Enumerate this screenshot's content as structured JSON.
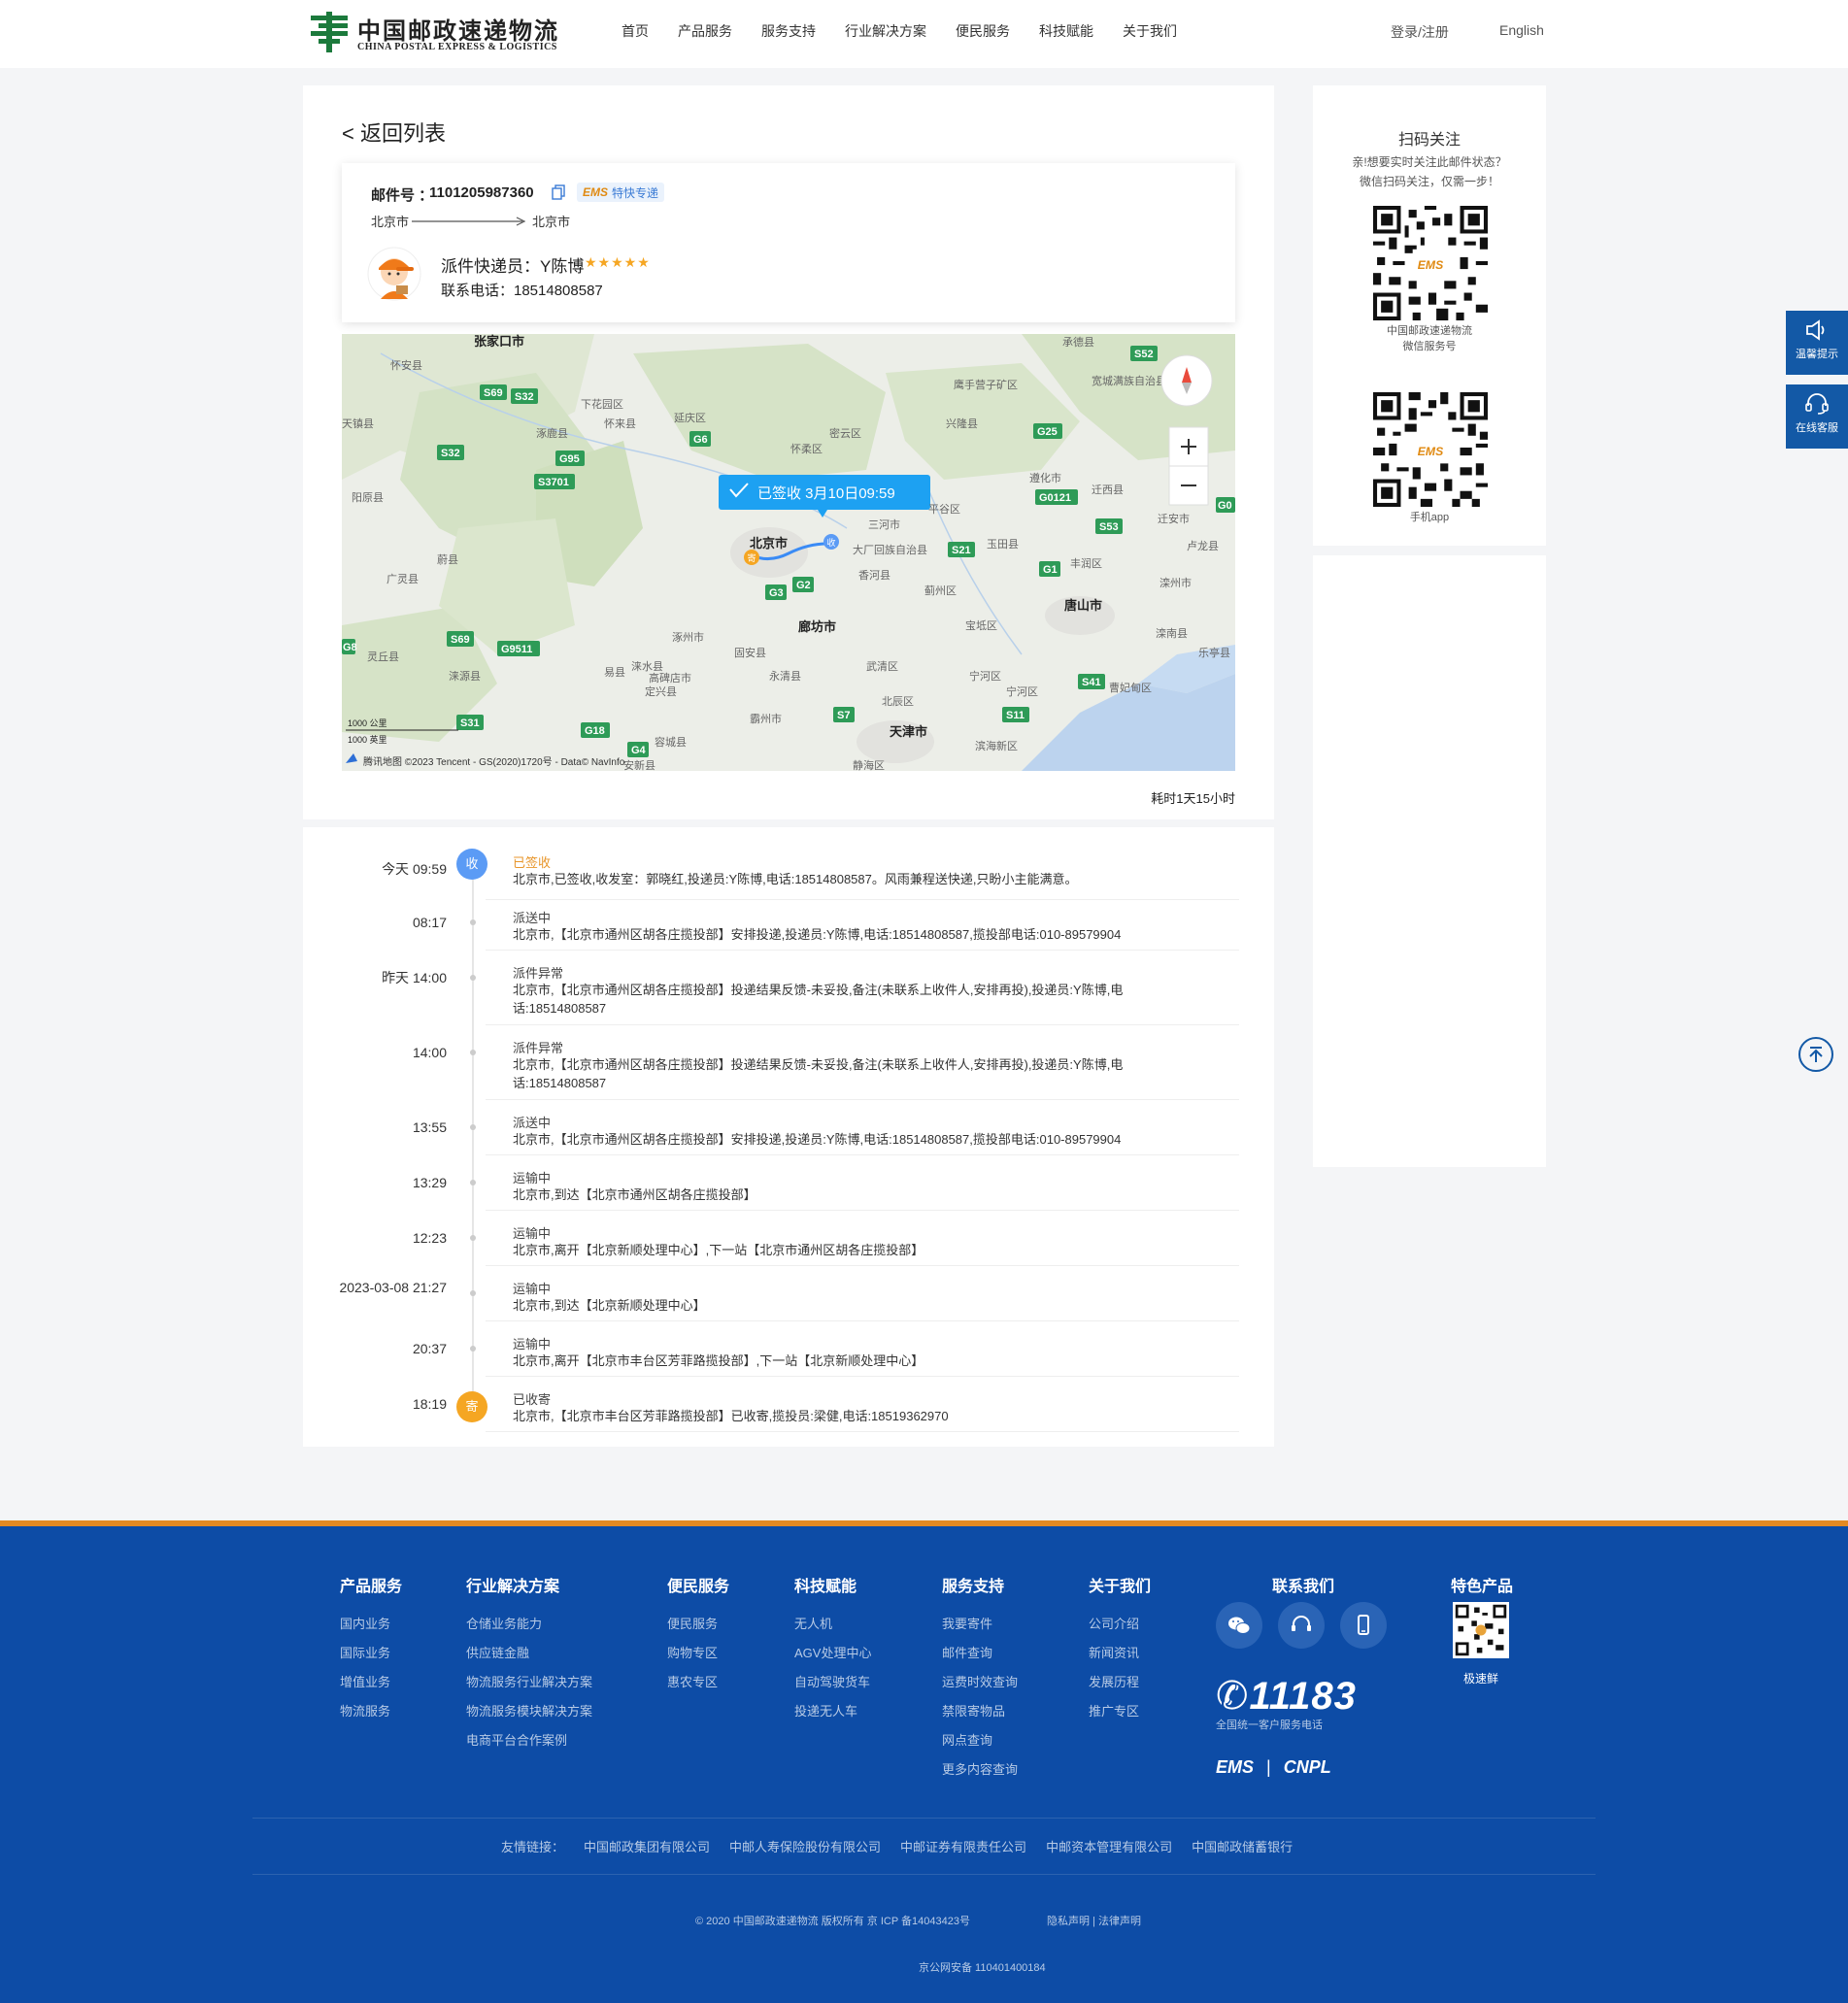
{
  "header": {
    "logo_cn": "中国邮政速递物流",
    "logo_en": "CHINA POSTAL EXPRESS & LOGISTICS",
    "nav": [
      "首页",
      "产品服务",
      "服务支持",
      "行业解决方案",
      "便民服务",
      "科技赋能",
      "关于我们"
    ],
    "login": "登录/注册",
    "language": "English"
  },
  "detail": {
    "back": "< 返回列表",
    "mail_label": "邮件号 ：",
    "mail_no": "1101205987360",
    "service_brand": "EMS",
    "service_name": "特快专递",
    "from_city": "北京市",
    "to_city": "北京市",
    "courier_label": "派件快递员：Y陈博",
    "rating_stars": 5,
    "phone_label": "联系电话：18514808587",
    "duration": "耗时1天15小时"
  },
  "map": {
    "popup": "已签收  3月10日09:59",
    "cities": [
      {
        "name": "张家口市",
        "bold": true
      },
      {
        "name": "北京市",
        "bold": true
      },
      {
        "name": "廊坊市",
        "bold": true
      },
      {
        "name": "唐山市",
        "bold": true
      },
      {
        "name": "天津市",
        "bold": true
      }
    ],
    "districts": [
      "怀安县",
      "下花园区",
      "涿鹿县",
      "怀来县",
      "延庆区",
      "密云区",
      "兴隆县",
      "宽城满族自治县",
      "天镇县",
      "阳原县",
      "蔚县",
      "广灵县",
      "灵丘县",
      "涞源县",
      "易县",
      "涞水县",
      "高碑店市",
      "定兴县",
      "固安县",
      "永清县",
      "霸州市",
      "安新县",
      "容城县",
      "静海区",
      "滨海新区",
      "宁河区",
      "遵化市",
      "迁西县",
      "迁安市",
      "卢龙县",
      "丰润区",
      "滦州市",
      "滦南县",
      "乐亭县",
      "曹妃甸区",
      "宁河区",
      "武清区",
      "北辰区",
      "宝坻区",
      "三河市",
      "大厂回族自治县",
      "香河县",
      "蓟州区",
      "玉田县",
      "平谷区",
      "怀柔区",
      "涿州市",
      "鹰手营子矿区",
      "承德县"
    ],
    "highways": [
      "S69",
      "S32",
      "G6",
      "G95",
      "S32",
      "S3701",
      "S52",
      "G25",
      "G0121",
      "S53",
      "G0",
      "S21",
      "G1",
      "G3",
      "G2",
      "S69",
      "G9511",
      "S41",
      "S7",
      "S11",
      "S31",
      "G18",
      "G4",
      "G8"
    ],
    "scale_km": "1000 公里",
    "scale_mi": "1000 英里",
    "attribution": "腾讯地图 ©2023 Tencent - GS(2020)1720号 - Data© NavInfo",
    "marker_recv": "收",
    "marker_send": "寄"
  },
  "timeline": [
    {
      "time": "今天 09:59",
      "status": "已签收",
      "detail": "北京市,已签收,收发室：郭晓红,投递员:Y陈博,电话:18514808587。风雨兼程送快递,只盼小主能满意。",
      "badge": "收"
    },
    {
      "time": "08:17",
      "status": "派送中",
      "detail": "北京市,【北京市通州区胡各庄揽投部】安排投递,投递员:Y陈博,电话:18514808587,揽投部电话:010-89579904"
    },
    {
      "time": "昨天 14:00",
      "status": "派件异常",
      "detail": "北京市,【北京市通州区胡各庄揽投部】投递结果反馈-未妥投,备注(未联系上收件人,安排再投),投递员:Y陈博,电话:18514808587"
    },
    {
      "time": "14:00",
      "status": "派件异常",
      "detail": "北京市,【北京市通州区胡各庄揽投部】投递结果反馈-未妥投,备注(未联系上收件人,安排再投),投递员:Y陈博,电话:18514808587"
    },
    {
      "time": "13:55",
      "status": "派送中",
      "detail": "北京市,【北京市通州区胡各庄揽投部】安排投递,投递员:Y陈博,电话:18514808587,揽投部电话:010-89579904"
    },
    {
      "time": "13:29",
      "status": "运输中",
      "detail": "北京市,到达【北京市通州区胡各庄揽投部】"
    },
    {
      "time": "12:23",
      "status": "运输中",
      "detail": "北京市,离开【北京新顺处理中心】,下一站【北京市通州区胡各庄揽投部】"
    },
    {
      "time": "2023-03-08 21:27",
      "status": "运输中",
      "detail": "北京市,到达【北京新顺处理中心】"
    },
    {
      "time": "20:37",
      "status": "运输中",
      "detail": "北京市,离开【北京市丰台区芳菲路揽投部】,下一站【北京新顺处理中心】"
    },
    {
      "time": "18:19",
      "status": "已收寄",
      "detail": "北京市,【北京市丰台区芳菲路揽投部】已收寄,揽投员:梁健,电话:18519362970",
      "badge": "寄"
    }
  ],
  "sidebar": {
    "title": "扫码关注",
    "sub1": "亲!想要实时关注此邮件状态？",
    "sub2": "微信扫码关注，仅需一步！",
    "qr1_cap1": "中国邮政速递物流",
    "qr1_cap2": "微信服务号",
    "qr2_cap": "手机app"
  },
  "float": {
    "tips": "温馨提示",
    "service": "在线客服"
  },
  "footer": {
    "columns": [
      {
        "title": "产品服务",
        "items": [
          "国内业务",
          "国际业务",
          "增值业务",
          "物流服务"
        ]
      },
      {
        "title": "行业解决方案",
        "items": [
          "仓储业务能力",
          "供应链金融",
          "物流服务行业解决方案",
          "物流服务模块解决方案",
          "电商平台合作案例"
        ]
      },
      {
        "title": "便民服务",
        "items": [
          "便民服务",
          "购物专区",
          "惠农专区"
        ]
      },
      {
        "title": "科技赋能",
        "items": [
          "无人机",
          "AGV处理中心",
          "自动驾驶货车",
          "投递无人车"
        ]
      },
      {
        "title": "服务支持",
        "items": [
          "我要寄件",
          "邮件查询",
          "运费时效查询",
          "禁限寄物品",
          "网点查询",
          "更多内容查询"
        ]
      },
      {
        "title": "关于我们",
        "items": [
          "公司介绍",
          "新闻资讯",
          "发展历程",
          "推广专区"
        ]
      }
    ],
    "contact_title": "联系我们",
    "hotline": "11183",
    "hotline_sub": "全国统一客户服务电话",
    "brand_ems": "EMS",
    "brand_cnpl": "CNPL",
    "feature_title": "特色产品",
    "feature_cap": "极速鲜",
    "friends_label": "友情链接：",
    "friends": [
      "中国邮政集团有限公司",
      "中邮人寿保险股份有限公司",
      "中邮证券有限责任公司",
      "中邮资本管理有限公司",
      "中国邮政储蓄银行"
    ],
    "copyright": "© 2020 中国邮政速递物流 版权所有 京 ICP 备14043423号",
    "legal": "隐私声明 | 法律声明",
    "gongan": "京公网安备 110401400184"
  },
  "colors": {
    "brand_blue": "#0d4ca6",
    "accent_orange": "#e48a23",
    "map_popup": "#1da1f2"
  }
}
